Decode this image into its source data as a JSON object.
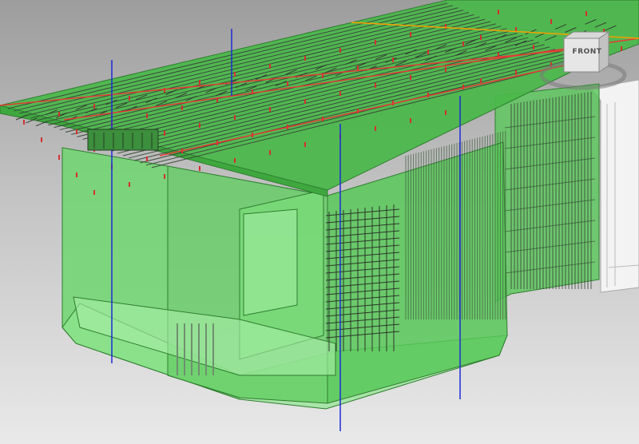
{
  "viewport": {
    "background_top": "#9d9d9d",
    "background_bottom": "#e9e9e9"
  },
  "model": {
    "concrete_color": "#4fc94f",
    "concrete_edge_color": "#2e7d2e",
    "rebar_color": "#3a4a3a",
    "section_line_color": "#e53935",
    "grid_line_color": "#1e2bd4",
    "selection_line_color": "#f5a000"
  },
  "viewcube": {
    "face_label": "FRONT",
    "icon": "viewcube-icon"
  }
}
